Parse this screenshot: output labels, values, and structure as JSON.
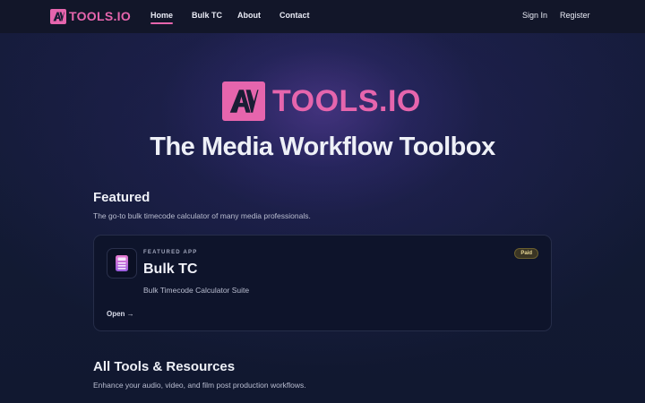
{
  "brand": {
    "logo_mark": "AV",
    "name": "TOOLS.IO",
    "accent": "#e665ad"
  },
  "nav": {
    "links": [
      {
        "label": "Home",
        "active": true
      },
      {
        "label": "Bulk TC",
        "active": false
      },
      {
        "label": "About",
        "active": false
      },
      {
        "label": "Contact",
        "active": false
      }
    ],
    "sign_in": "Sign In",
    "register": "Register"
  },
  "hero": {
    "title": "The Media Workflow Toolbox"
  },
  "featured": {
    "title": "Featured",
    "subtitle": "The go-to bulk timecode calculator of many media professionals.",
    "card": {
      "icon": "calculator-icon",
      "eyebrow": "FEATURED APP",
      "title": "Bulk TC",
      "description": "Bulk Timecode Calculator Suite",
      "open_label": "Open →",
      "badge": "Paid"
    }
  },
  "all_tools": {
    "title": "All Tools & Resources",
    "subtitle": "Enhance your audio, video, and film post production workflows."
  }
}
